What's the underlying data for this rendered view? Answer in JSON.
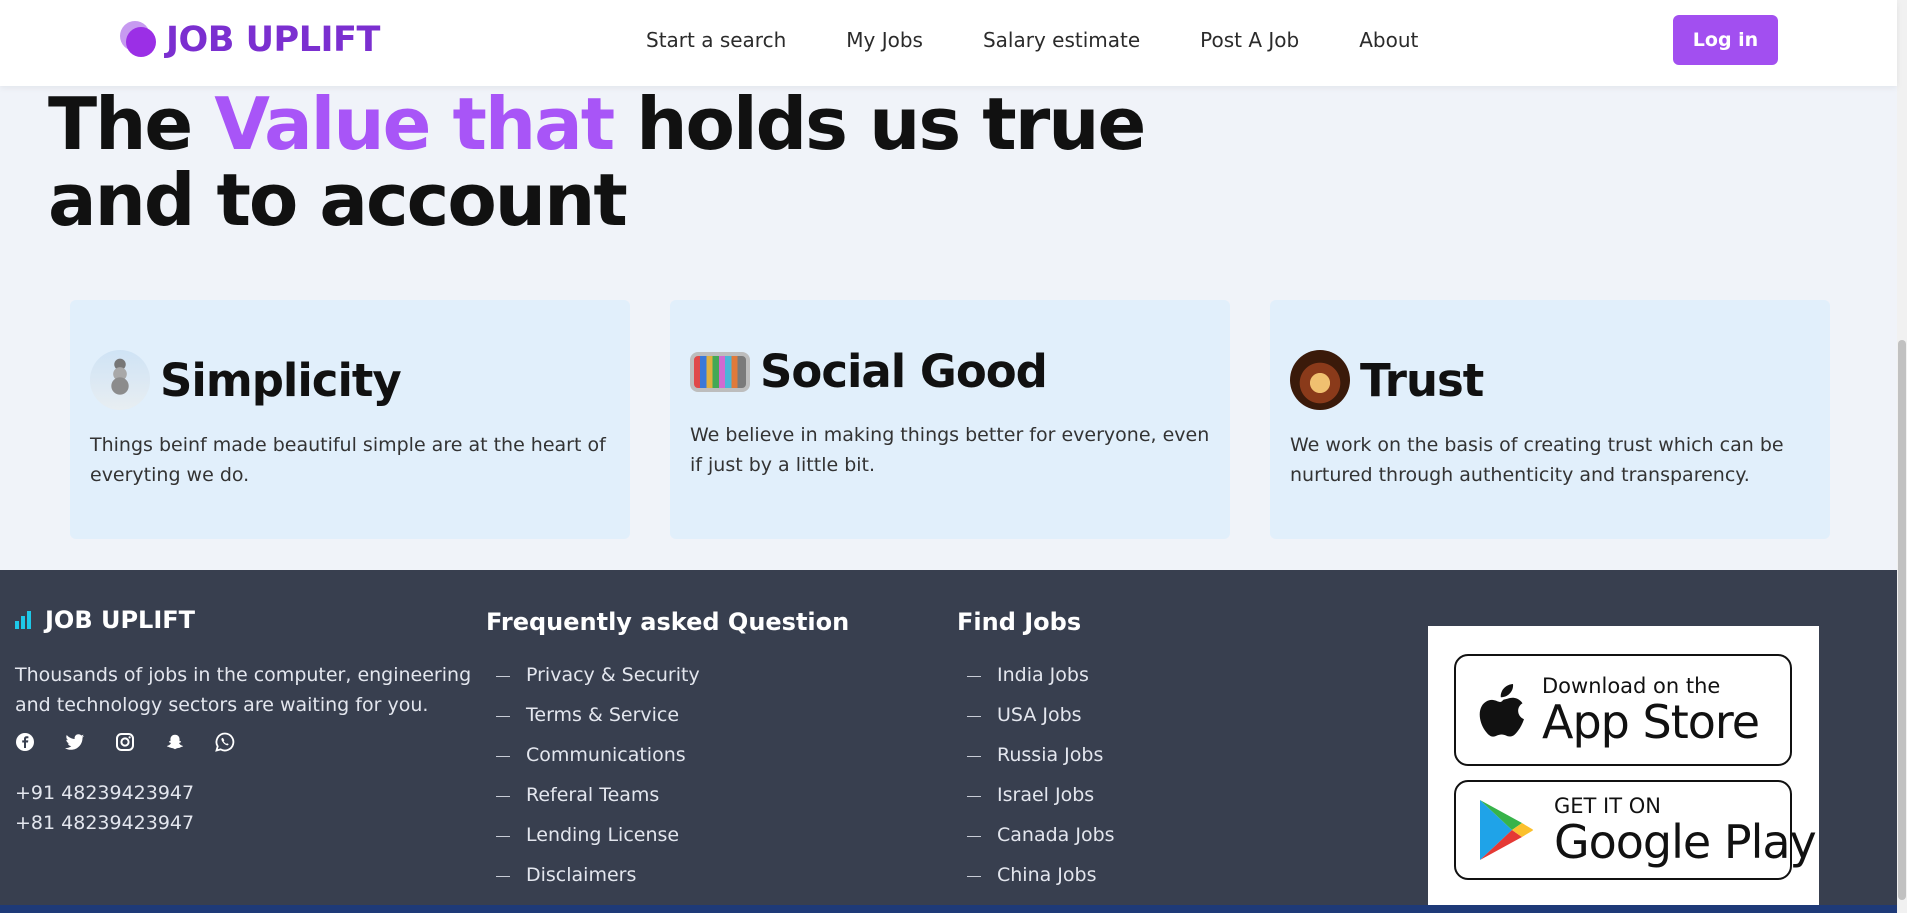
{
  "navbar": {
    "brand": "JOB UPLIFT",
    "links": [
      "Start a search",
      "My Jobs",
      "Salary estimate",
      "Post A Job",
      "About"
    ],
    "login_label": "Log in"
  },
  "hero": {
    "title_part1": "The ",
    "title_accent": "Value that",
    "title_part2": " holds us true and to account"
  },
  "values": [
    {
      "title": "Simplicity",
      "text": "Things beinf made beautiful simple are at the heart of everyting we do.",
      "icon": "stones-icon"
    },
    {
      "title": "Social Good",
      "text": "We believe in making things better for everyone, even if just by a little bit.",
      "icon": "people-icon"
    },
    {
      "title": "Trust",
      "text": "We work on the basis of creating trust which can be nurtured through authenticity and transparency.",
      "icon": "trust-icon"
    }
  ],
  "footer": {
    "brand": "JOB UPLIFT",
    "description": "Thousands of jobs in the computer, engineering and technology sectors are waiting for you.",
    "social_icons": [
      "facebook-icon",
      "twitter-icon",
      "instagram-icon",
      "snapchat-icon",
      "whatsapp-icon"
    ],
    "phones": [
      "+91 48239423947",
      "+81 48239423947"
    ],
    "faq_heading": "Frequently asked Question",
    "faq_items": [
      "Privacy & Security",
      "Terms & Service",
      "Communications",
      "Referal Teams",
      "Lending License",
      "Disclaimers"
    ],
    "jobs_heading": "Find Jobs",
    "jobs_items": [
      "India Jobs",
      "USA Jobs",
      "Russia Jobs",
      "Israel Jobs",
      "Canada Jobs",
      "China Jobs"
    ],
    "app_store": {
      "small": "Download on the",
      "big": "App Store"
    },
    "google_play": {
      "small": "GET IT ON",
      "big": "Google Play"
    }
  },
  "colors": {
    "accent": "#a855f7",
    "brand": "#7b2fd0",
    "login_button": "#a24ff0",
    "card_bg": "#e1effb",
    "footer_bg": "#383f4f",
    "page_bg": "#f0f3f9"
  }
}
